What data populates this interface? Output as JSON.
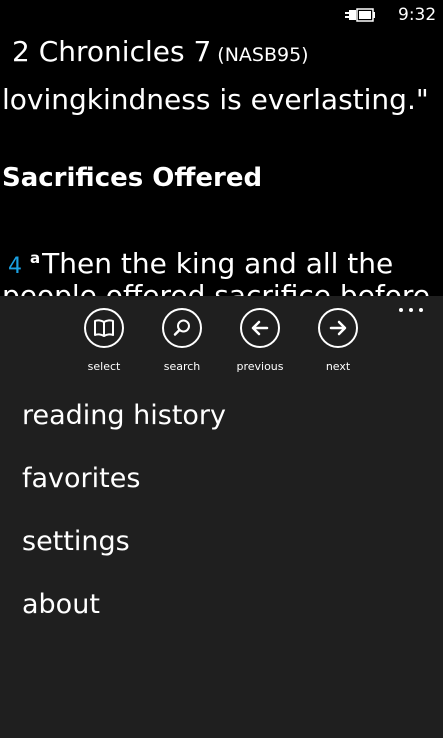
{
  "status_bar": {
    "time": "9:32",
    "battery_icon": "battery-charging-icon"
  },
  "header": {
    "title": "2 Chronicles 7",
    "version": "(NASB95)"
  },
  "reading": {
    "verse_tail": "lovingkindness is everlasting.\"",
    "section_heading": "Sacrifices Offered",
    "verse_number": "4",
    "footnote_marker": "a",
    "verse_text": "Then the king and all the",
    "verse_text_cut": "people offered sacrifice before"
  },
  "app_bar": {
    "more_icon": "ellipsis-icon",
    "buttons": [
      {
        "label": "select",
        "icon": "book-icon"
      },
      {
        "label": "search",
        "icon": "search-icon"
      },
      {
        "label": "previous",
        "icon": "arrow-left-icon"
      },
      {
        "label": "next",
        "icon": "arrow-right-icon"
      }
    ],
    "menu_items": [
      "reading history",
      "favorites",
      "settings",
      "about"
    ]
  }
}
